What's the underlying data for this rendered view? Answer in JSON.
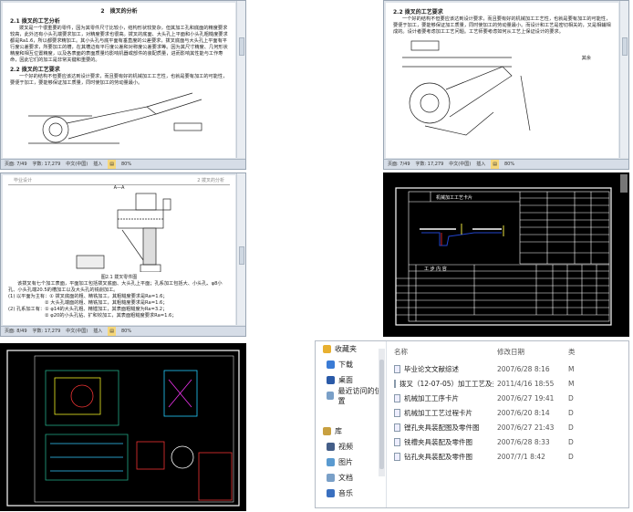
{
  "doc1": {
    "title": "2　拨叉的分析",
    "s1": "2.1 拨叉的工艺分析",
    "p1": "拨叉是一个很重要的零件，因为其零件尺寸比较小，结构形状较复杂，但其加工孔和底面的精度要求较高，此外还有小头孔端要求加工，对精度要求也很高。拨叉的底面、大头孔上平面和小头孔粗糙度要求都是Ra1.6，所以都要求精加工。其小头孔与底平面有垂直度的公差要求，拨叉底面与大头孔上平面有平行度公差要求，所要加工的槽，在其槽边有平行度公差和对称度公差要求等。因为其尺寸精度、几何形状精度和相互位置精度，以及各表面的表面质量均影响机器或部件的装配质量，进而影响其性能与工作寿命，因此它们的加工是非常关键和重要的。",
    "s2": "2.2 拨叉的工艺要求",
    "p2": "一个好的结构不但要应该达到设计要求，而且要有好的机械加工工艺性，也就是要有加工的可能性，要便于加工，要能够保证加工质量，同时使加工的劳动量最小。",
    "status": {
      "page": "页面: 7/49",
      "words": "字数: 17,279",
      "lang": "中文(中国)",
      "mode": "插入",
      "zoom": "80%"
    }
  },
  "doc2": {
    "s2": "2.2 拨叉的工艺要求",
    "p2": "一个好的结构不但要应该达到设计要求，而且要有好的机械加工工艺性，也就是要有加工的可能性，要便于加工，要能够保证加工质量，同时使加工的劳动量最小。而设计和工艺是密切相关的，又是相辅相成的。设计者要考虑加工工艺问题。工艺师要考虑如何从工艺上保证设计的要求。",
    "rest": "其余",
    "status": {
      "page": "页面: 7/49",
      "words": "字数: 17,279",
      "lang": "中文(中国)",
      "mode": "插入",
      "zoom": "80%"
    }
  },
  "doc3": {
    "header_left": "毕业设计",
    "header_right": "2 拨叉的分析",
    "section": "A—A",
    "caption": "图2.1 拨叉零件图",
    "p1": "该拨叉有七个加工表面，平面加工包括拨叉底面、大头孔上平面；孔系加工包括大、小头孔、φ8小孔、小头孔端20.5的槽加工以及大头孔的铣削加工。",
    "l1": "(1) 以平面为主有：① 拨叉底面的粗、精铣加工，其粗糙度要求是Ra=1.6；",
    "l2": "② 大头孔端面的粗、精铣加工，其粗糙度要求是Ra=1.6；",
    "l3": "(2) 孔系加工有：① φ14的大头孔粗、精镗加工，其表面粗糙度为Ra=3.2；",
    "l4": "② φ20的小头孔钻、扩和铰加工，其表面粗糙度要求Ra=1.6；",
    "status": {
      "page": "页面: 8/49",
      "words": "字数: 17,279",
      "lang": "中文(中国)",
      "mode": "插入",
      "zoom": "80%"
    }
  },
  "cad": {
    "title": "机械加工工艺卡片",
    "content_header": "工 步 内 容"
  },
  "explorer": {
    "sidebar": [
      {
        "label": "收藏夹",
        "icon": "star-icon",
        "color": "#e8b030"
      },
      {
        "label": "下载",
        "icon": "download-folder-icon",
        "color": "#3a7bd5"
      },
      {
        "label": "桌面",
        "icon": "desktop-icon",
        "color": "#2a5aa8"
      },
      {
        "label": "最近访问的位置",
        "icon": "recent-places-icon",
        "color": "#7aa0c8"
      },
      {
        "label": "库",
        "icon": "library-icon",
        "color": "#c8a040"
      },
      {
        "label": "视频",
        "icon": "video-icon",
        "color": "#445e88"
      },
      {
        "label": "图片",
        "icon": "pictures-icon",
        "color": "#5a9ad0"
      },
      {
        "label": "文档",
        "icon": "documents-icon",
        "color": "#7aa0c8"
      },
      {
        "label": "音乐",
        "icon": "music-icon",
        "color": "#3a70c0"
      }
    ],
    "columns": {
      "name": "名称",
      "date": "修改日期",
      "type": "类"
    },
    "files": [
      {
        "name": "毕业论文文献综述",
        "date": "2007/6/28 8:16",
        "type": "M"
      },
      {
        "name": "拨叉（12-07-05）加工工艺及夹具设计...",
        "date": "2011/4/16 18:55",
        "type": "M"
      },
      {
        "name": "机械加工工序卡片",
        "date": "2007/6/27 19:41",
        "type": "D"
      },
      {
        "name": "机械加工工艺过程卡片",
        "date": "2007/6/20 8:14",
        "type": "D"
      },
      {
        "name": "镗孔夹具装配图及零件图",
        "date": "2007/6/27 21:43",
        "type": "D"
      },
      {
        "name": "铣槽夹具装配及零件图",
        "date": "2007/6/28 8:33",
        "type": "D"
      },
      {
        "name": "钻孔夹具装配及零件图",
        "date": "2007/7/1 8:42",
        "type": "D"
      }
    ]
  }
}
